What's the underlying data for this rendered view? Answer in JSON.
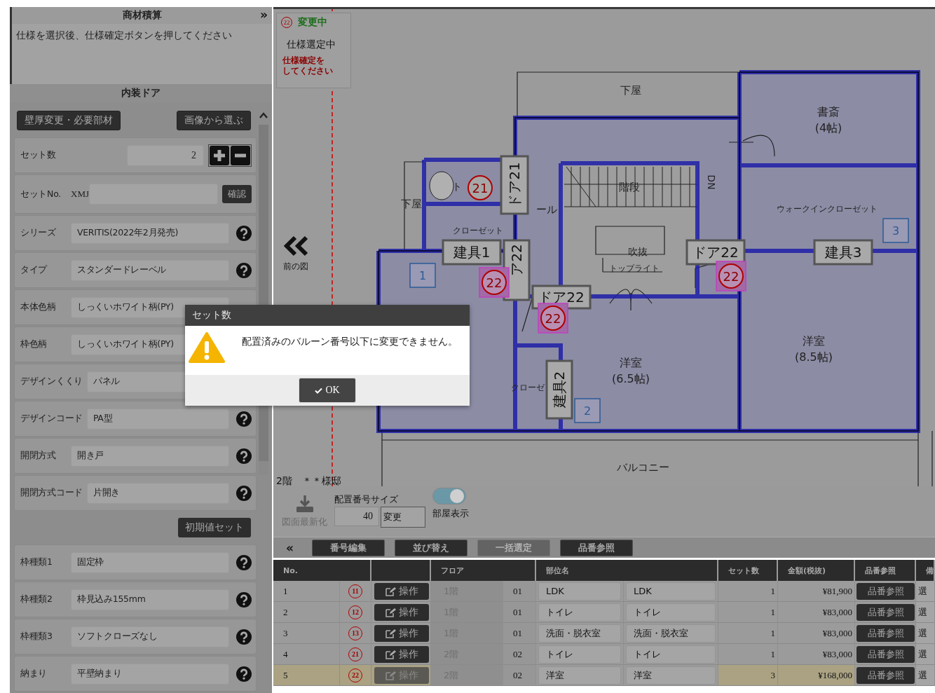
{
  "left_panel": {
    "title": "商材積算",
    "collapse_icon": "»",
    "message": "仕様を選択後、仕様確定ボタンを押してください",
    "section_title": "内装ドア",
    "buttons": [
      "壁厚変更・必要部材",
      "画像から選ぶ"
    ],
    "set_count": {
      "label": "セット数",
      "value": "2"
    },
    "set_no": {
      "label": "セットNo.",
      "prefix": "XMJ",
      "button": "確認"
    },
    "fields": [
      {
        "label": "シリーズ",
        "value": "VERITIS(2022年2月発売)",
        "help": true
      },
      {
        "label": "タイプ",
        "value": "スタンダードレーベル",
        "help": true
      },
      {
        "label": "本体色柄",
        "value": "しっくいホワイト柄(PY)",
        "help": false
      },
      {
        "label": "枠色柄",
        "value": "しっくいホワイト柄(PY)",
        "help": false
      },
      {
        "label": "デザインくくり",
        "value": "パネル",
        "help": false
      },
      {
        "label": "デザインコード",
        "value": "PA型",
        "help": true
      },
      {
        "label": "開閉方式",
        "value": "開き戸",
        "help": true
      },
      {
        "label": "開閉方式コード",
        "value": "片開き",
        "help": true
      }
    ],
    "reset_button": "初期値セット",
    "fields_2": [
      {
        "label": "枠種類1",
        "value": "固定枠",
        "help": true
      },
      {
        "label": "枠種類2",
        "value": "枠見込み155mm",
        "help": true
      },
      {
        "label": "枠種類3",
        "value": "ソフトクローズなし",
        "help": true
      },
      {
        "label": "納まり",
        "value": "平壁納まり",
        "help": true
      }
    ]
  },
  "status_box": {
    "balloon": "22",
    "state": "変更中",
    "status": "仕様選定中",
    "warning_lines": [
      "仕様確定を",
      "してください"
    ]
  },
  "prev_nav": {
    "label": "前の図"
  },
  "floor_plan": {
    "room_labels": [
      "下屋",
      "書斎",
      "(4帖)",
      "下屋",
      "ール",
      "階段",
      "DN",
      "クローゼット",
      "ウォークインクローゼット",
      "吹抜",
      "トップライト",
      "洋室",
      "(6.5帖)",
      "洋室",
      "(8.5帖)",
      "クローゼ",
      "バルコニー",
      "ト"
    ],
    "fixture_tags": [
      "ドア21",
      "建具1",
      "ア22",
      "ドア22",
      "ドア22",
      "建具3",
      "建具2"
    ],
    "balloons": [
      {
        "number": "21",
        "highlighted": false
      },
      {
        "number": "22",
        "highlighted": true
      },
      {
        "number": "22",
        "highlighted": true
      },
      {
        "number": "22",
        "highlighted": true
      }
    ],
    "room_numbers": [
      "1",
      "2",
      "3"
    ],
    "caption": "2階　＊＊様邸"
  },
  "plan_toolbar": {
    "refresh_label": "図面最新化",
    "size_label": "配置番号サイズ",
    "size_value": "40",
    "change_button": "変更",
    "toggle": {
      "label": "部屋表示",
      "on": true
    }
  },
  "table_toolbar": {
    "collapse_icon": "«",
    "buttons": [
      {
        "label": "番号編集",
        "disabled": false
      },
      {
        "label": "並び替え",
        "disabled": false
      },
      {
        "label": "一括選定",
        "disabled": true
      },
      {
        "label": "品番参照",
        "disabled": false
      }
    ]
  },
  "table": {
    "columns": [
      "No.",
      "フロア",
      "部位名",
      "セット数",
      "金額(税抜)",
      "品番参照",
      "備"
    ],
    "rows": [
      {
        "no": "1",
        "balloon": "11",
        "action": "操作",
        "floor": "1階",
        "floor_code": "01",
        "part": "LDK",
        "part_2": "LDK",
        "sets": "1",
        "price": "¥81,900",
        "ref": "品番参照",
        "extra": "選",
        "selected": false
      },
      {
        "no": "2",
        "balloon": "12",
        "action": "操作",
        "floor": "1階",
        "floor_code": "01",
        "part": "トイレ",
        "part_2": "トイレ",
        "sets": "1",
        "price": "¥83,000",
        "ref": "品番参照",
        "extra": "選",
        "selected": false
      },
      {
        "no": "3",
        "balloon": "13",
        "action": "操作",
        "floor": "1階",
        "floor_code": "01",
        "part": "洗面・脱衣室",
        "part_2": "洗面・脱衣室",
        "sets": "1",
        "price": "¥83,000",
        "ref": "品番参照",
        "extra": "選",
        "selected": false
      },
      {
        "no": "4",
        "balloon": "21",
        "action": "操作",
        "floor": "2階",
        "floor_code": "02",
        "part": "トイレ",
        "part_2": "トイレ",
        "sets": "1",
        "price": "¥83,000",
        "ref": "品番参照",
        "extra": "選",
        "selected": false
      },
      {
        "no": "5",
        "balloon": "22",
        "action": "操作",
        "floor": "2階",
        "floor_code": "02",
        "part": "洋室",
        "part_2": "洋室",
        "sets": "3",
        "price": "¥168,000",
        "ref": "品番参照",
        "extra": "選",
        "selected": true
      }
    ]
  },
  "dialog": {
    "title": "セット数",
    "message": "配置済みのバルーン番号以下に変更できません。",
    "ok": "OK"
  }
}
